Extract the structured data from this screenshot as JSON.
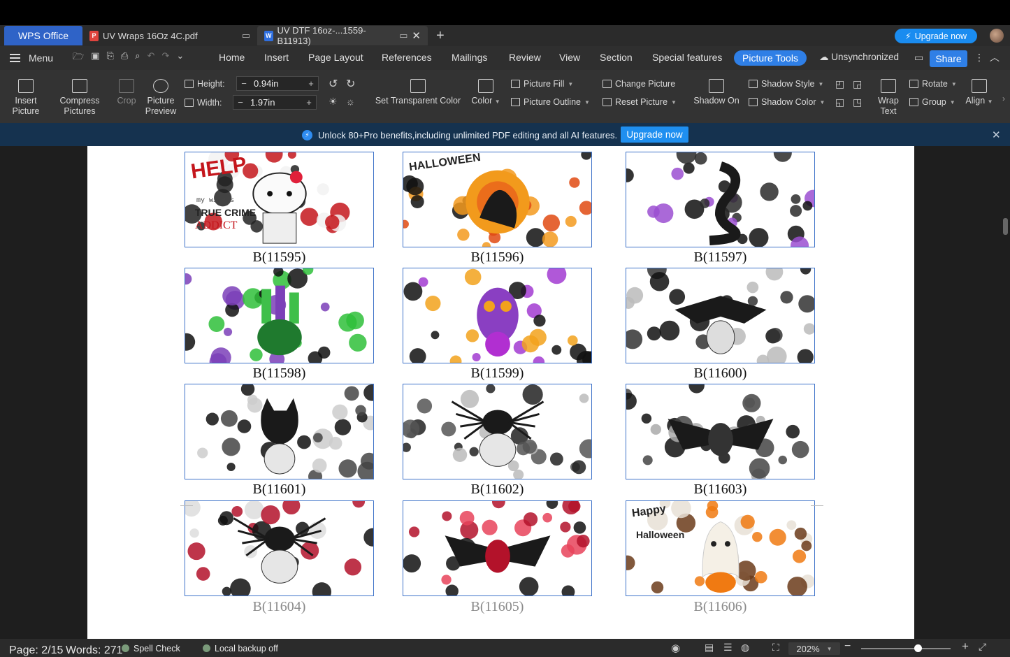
{
  "tabs": {
    "app": "WPS Office",
    "doc1": "UV Wraps 16Oz  4C.pdf",
    "doc2": "UV DTF 16oz-...1559-B11913)",
    "upgrade": "Upgrade now"
  },
  "menu": {
    "menu_label": "Menu",
    "items": [
      "Home",
      "Insert",
      "Page Layout",
      "References",
      "Mailings",
      "Review",
      "View",
      "Section",
      "Special features"
    ],
    "active": "Picture Tools",
    "unsync": "Unsynchronized",
    "share": "Share"
  },
  "ribbon": {
    "insert_picture": "Insert\nPicture",
    "compress": "Compress\nPictures",
    "crop": "Crop",
    "preview": "Picture\nPreview",
    "height_label": "Height:",
    "height_value": "0.94in",
    "width_label": "Width:",
    "width_value": "1.97in",
    "transparent": "Set Transparent Color",
    "color": "Color",
    "picture_fill": "Picture Fill",
    "picture_outline": "Picture Outline",
    "change_picture": "Change Picture",
    "reset_picture": "Reset Picture",
    "shadow_on": "Shadow On",
    "shadow_style": "Shadow Style",
    "shadow_color": "Shadow Color",
    "wrap_text": "Wrap\nText",
    "rotate": "Rotate",
    "group": "Group",
    "align": "Align"
  },
  "promo": {
    "text": "Unlock 80+Pro benefits,including unlimited PDF editing and all AI features.",
    "button": "Upgrade now"
  },
  "images": [
    {
      "label": "B(11595)",
      "theme": "kitty-crime",
      "text": "HELP",
      "sub": "TRUE CRIME",
      "sub2": "ADDICT",
      "small": "my wife's"
    },
    {
      "label": "B(11596)",
      "theme": "halloween-raven",
      "text": "HALLOWEEN"
    },
    {
      "label": "B(11597)",
      "theme": "cobra-roses"
    },
    {
      "label": "B(11598)",
      "theme": "witch-potions"
    },
    {
      "label": "B(11599)",
      "theme": "owl-roses"
    },
    {
      "label": "B(11600)",
      "theme": "eagle-skull"
    },
    {
      "label": "B(11601)",
      "theme": "cat-skull"
    },
    {
      "label": "B(11602)",
      "theme": "spider-skull"
    },
    {
      "label": "B(11603)",
      "theme": "bat-mono"
    },
    {
      "label": "B(11604)",
      "theme": "spider-red"
    },
    {
      "label": "B(11605)",
      "theme": "bat-red"
    },
    {
      "label": "B(11606)",
      "theme": "ghost-pumpkin",
      "text": "Happy",
      "sub": "Halloween"
    }
  ],
  "colors": {
    "accent": "#2f7fe6",
    "frame": "#3f73c9",
    "promo_bg": "#15324f"
  },
  "status": {
    "page": "Page: 2/15",
    "words": "Words: 271",
    "spell": "Spell Check",
    "backup": "Local backup off",
    "zoom": "202%"
  }
}
